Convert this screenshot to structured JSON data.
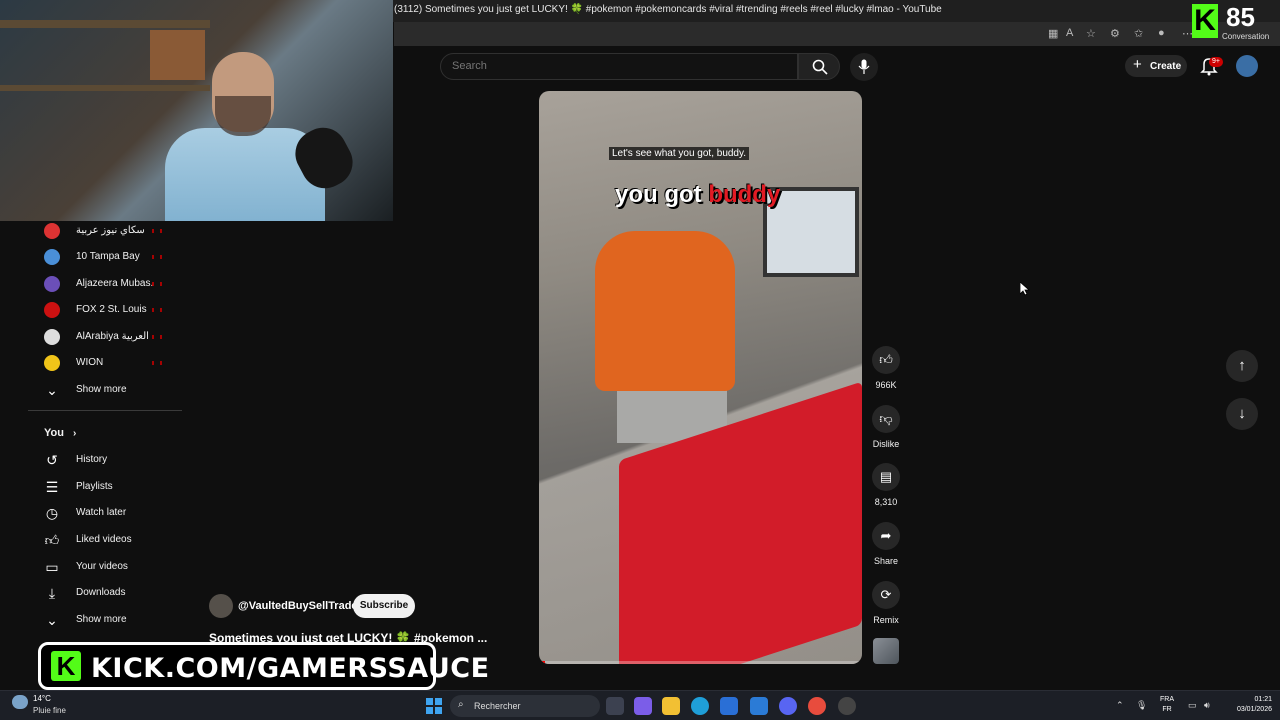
{
  "window": {
    "title": "(3112) Sometimes you just get LUCKY! 🍀 #pokemon #pokemoncards #viral #trending #reels #reel #lucky #lmao - YouTube"
  },
  "overlay": {
    "kick_counter": "85",
    "kick_counter_sub": "Conversation",
    "kick_logo": "K",
    "kick_banner": "KICK.COM/GAMERSSAUCE"
  },
  "header": {
    "search_placeholder": "Search",
    "create_label": "Create",
    "notifications_badge": "9+"
  },
  "sidebar": {
    "subscriptions": [
      {
        "label": "سكاي نيوز عربية",
        "color": "#d33"
      },
      {
        "label": "10 Tampa Bay",
        "color": "#4a8fd8"
      },
      {
        "label": "Aljazeera Mubas...",
        "color": "#6b4fb8"
      },
      {
        "label": "FOX 2 St. Louis",
        "color": "#c11"
      },
      {
        "label": "AlArabiya العربية",
        "color": "#ddd"
      },
      {
        "label": "WION",
        "color": "#f0c419"
      }
    ],
    "show_more_1": "Show more",
    "you_label": "You",
    "you_items": [
      {
        "label": "History",
        "icon": "history-icon"
      },
      {
        "label": "Playlists",
        "icon": "playlists-icon"
      },
      {
        "label": "Watch later",
        "icon": "watch-later-icon"
      },
      {
        "label": "Liked videos",
        "icon": "like-icon"
      },
      {
        "label": "Your videos",
        "icon": "your-videos-icon"
      },
      {
        "label": "Downloads",
        "icon": "download-icon"
      }
    ],
    "show_more_2": "Show more"
  },
  "video": {
    "caption_small": "Let's see what you got, buddy.",
    "caption_big_white": "you got ",
    "caption_big_red": "buddy",
    "progress_fraction": 0.02
  },
  "actions": {
    "likes": "966K",
    "dislike": "Dislike",
    "comments": "8,310",
    "share": "Share",
    "remix": "Remix"
  },
  "channel": {
    "handle": "@VaultedBuySellTrade",
    "subscribe_label": "Subscribe",
    "short_title": "Sometimes you just get LUCKY! 🍀 #pokemon ..."
  },
  "taskbar": {
    "temperature": "14°C",
    "condition": "Pluie fine",
    "search_label": "Rechercher",
    "lang_1": "FRA",
    "lang_2": "FR",
    "time": "01:21",
    "date": "03/01/2026"
  },
  "colors": {
    "background": "#0f0f0f",
    "kick_green": "#53fc18",
    "youtube_red": "#ff0000"
  }
}
